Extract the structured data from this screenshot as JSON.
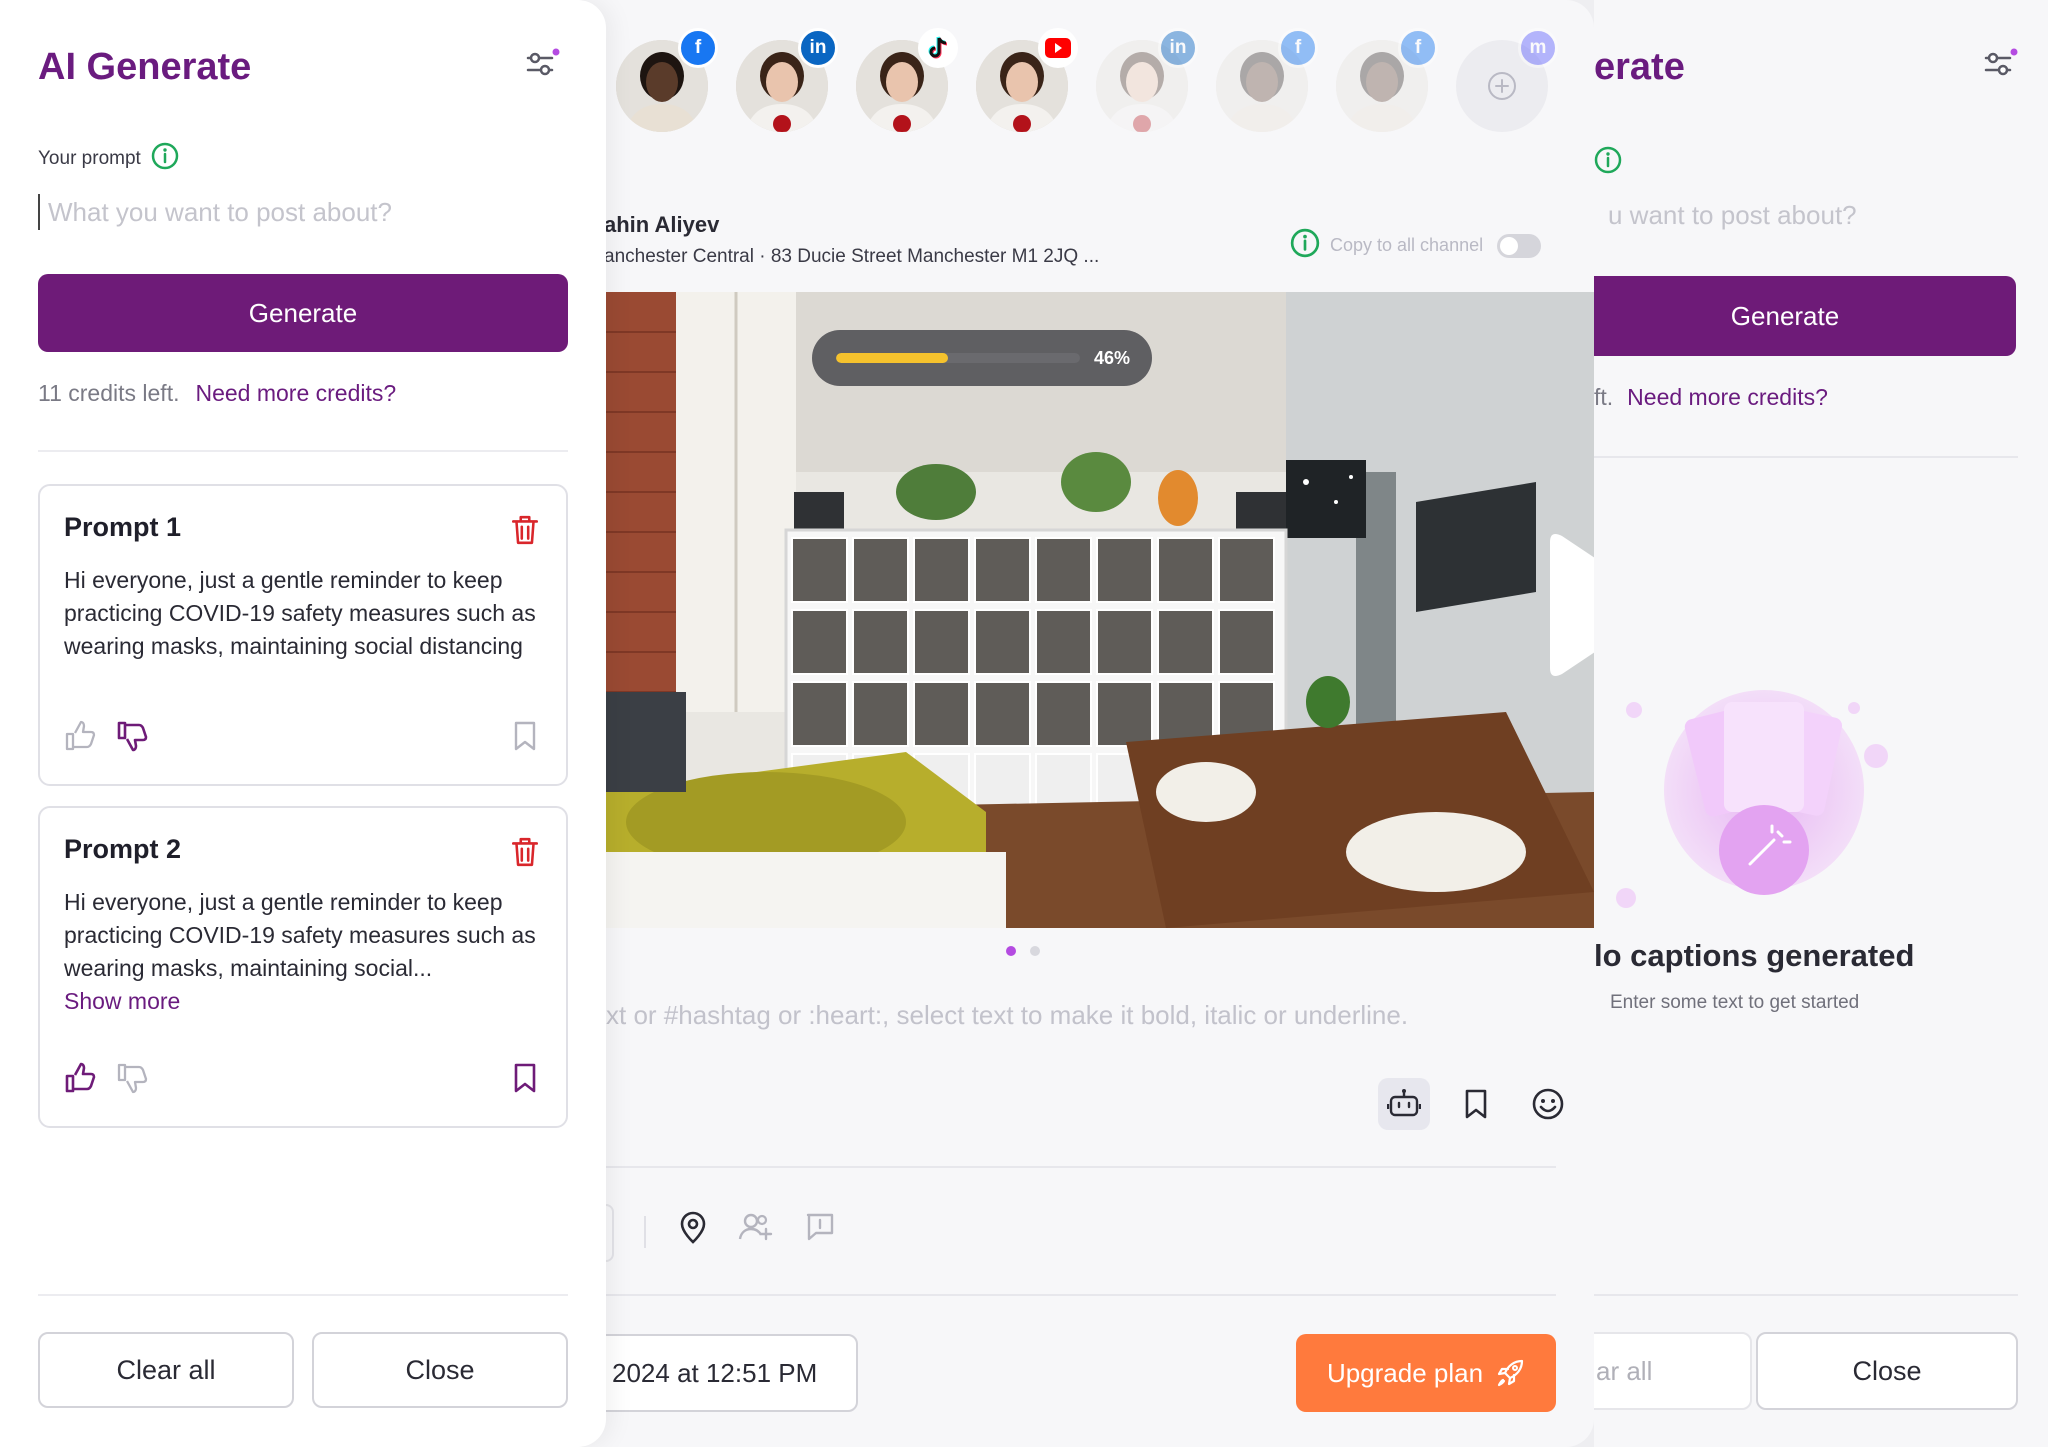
{
  "colors": {
    "brand_purple": "#6e1b78",
    "accent_orange": "#ff7a3d",
    "progress_yellow": "#f5c22d",
    "danger_red": "#d9262b",
    "info_green": "#1fa85a"
  },
  "left_panel": {
    "title": "AI Generate",
    "settings_icon": "sliders-icon",
    "prompt_label": "Your prompt",
    "prompt_placeholder": "What you want to post about?",
    "prompt_value": "",
    "generate_label": "Generate",
    "credits_text": "11 credits left.",
    "more_credits_link": "Need more credits?",
    "prompts": [
      {
        "title": "Prompt 1",
        "text": "Hi everyone, just a gentle reminder to keep practicing COVID-19 safety measures such as wearing masks, maintaining social distancing",
        "show_more": "",
        "liked": false,
        "disliked": true,
        "bookmarked": false
      },
      {
        "title": "Prompt 2",
        "text": "Hi everyone, just a gentle reminder to keep practicing COVID-19 safety measures such as wearing masks, maintaining social...",
        "show_more": "Show more",
        "liked": true,
        "disliked": false,
        "bookmarked": true
      }
    ],
    "clear_all_label": "Clear all",
    "close_label": "Close"
  },
  "composer": {
    "channels": [
      {
        "network": "facebook",
        "icon": "facebook-icon",
        "person": "man",
        "faded": false
      },
      {
        "network": "linkedin",
        "icon": "linkedin-icon",
        "person": "woman",
        "faded": false
      },
      {
        "network": "tiktok",
        "icon": "tiktok-icon",
        "person": "woman",
        "faded": false
      },
      {
        "network": "youtube",
        "icon": "youtube-icon",
        "person": "woman",
        "faded": false
      },
      {
        "network": "linkedin",
        "icon": "linkedin-icon",
        "person": "woman",
        "faded": true
      },
      {
        "network": "facebook",
        "icon": "facebook-icon",
        "person": "man",
        "faded": true
      },
      {
        "network": "facebook",
        "icon": "facebook-icon",
        "person": "man",
        "faded": true
      },
      {
        "network": "mastodon",
        "icon": "mastodon-icon",
        "person": "add",
        "faded": true
      }
    ],
    "profile_name": "ahin Aliyev",
    "profile_location": "anchester Central · 83 Ducie Street Manchester M1 2JQ ...",
    "copy_all_label": "Copy to all channel",
    "copy_all_enabled": false,
    "upload_progress": 46,
    "upload_progress_label": "46%",
    "carousel_pages": 2,
    "carousel_active": 0,
    "caption_placeholder": "xt or #hashtag or :heart:, select text to make it bold, italic or underline.",
    "editor_tools": [
      "robot-icon",
      "bookmark-icon",
      "emoji-icon"
    ],
    "extra_tools": [
      "location-pin-icon",
      "tag-users-icon",
      "comment-icon"
    ],
    "schedule_label": "2024 at 12:51 PM",
    "upgrade_label": "Upgrade plan"
  },
  "right_panel": {
    "title": "erate",
    "placeholder": "u want to post about?",
    "generate_label": "Generate",
    "credits_text": "ft.",
    "more_credits_link": "Need more credits?",
    "empty_title": "lo captions generated",
    "empty_subtitle": "Enter some text to get started",
    "clear_all_label": "ar all",
    "close_label": "Close"
  }
}
